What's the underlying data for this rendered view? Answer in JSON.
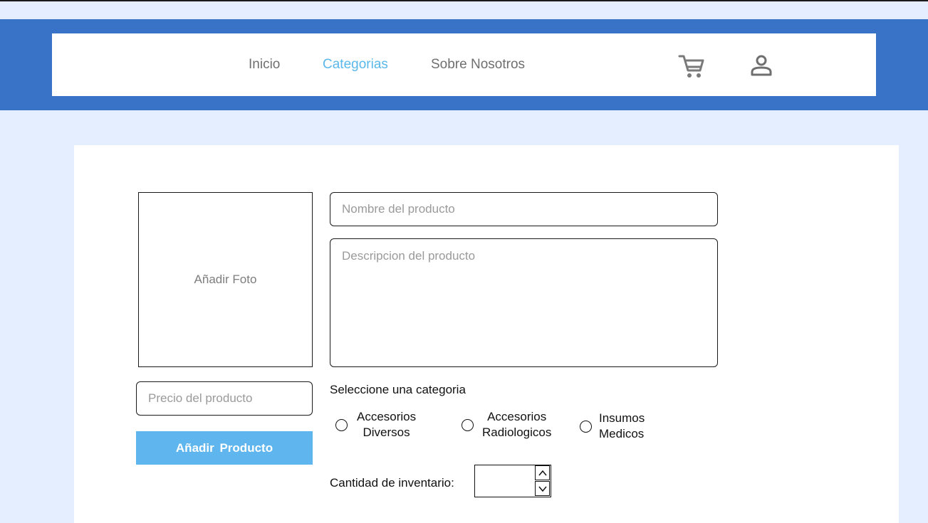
{
  "nav": {
    "links": [
      {
        "label": "Inicio",
        "active": false
      },
      {
        "label": "Categorias",
        "active": true
      },
      {
        "label": "Sobre Nosotros",
        "active": false
      }
    ],
    "cart_icon": "cart-icon",
    "user_icon": "user-icon"
  },
  "form": {
    "photo_label": "Añadir Foto",
    "name_placeholder": "Nombre del producto",
    "description_placeholder": "Descripcion del producto",
    "price_placeholder": "Precio del producto",
    "add_button_label": "Añadir Producto",
    "category_prompt": "Seleccione una categoria",
    "categories": [
      {
        "label": "Accesorios\nDiversos",
        "selected": false
      },
      {
        "label": "Accesorios\nRadiologicos",
        "selected": false
      },
      {
        "label": "Insumos\nMedicos",
        "selected": false
      }
    ],
    "quantity_label": "Cantidad de inventario:",
    "quantity_value": ""
  },
  "colors": {
    "header_band": "#3873c7",
    "page_background": "#e4eeff",
    "nav_active": "#5bb8ea",
    "button": "#5fb5ee"
  }
}
